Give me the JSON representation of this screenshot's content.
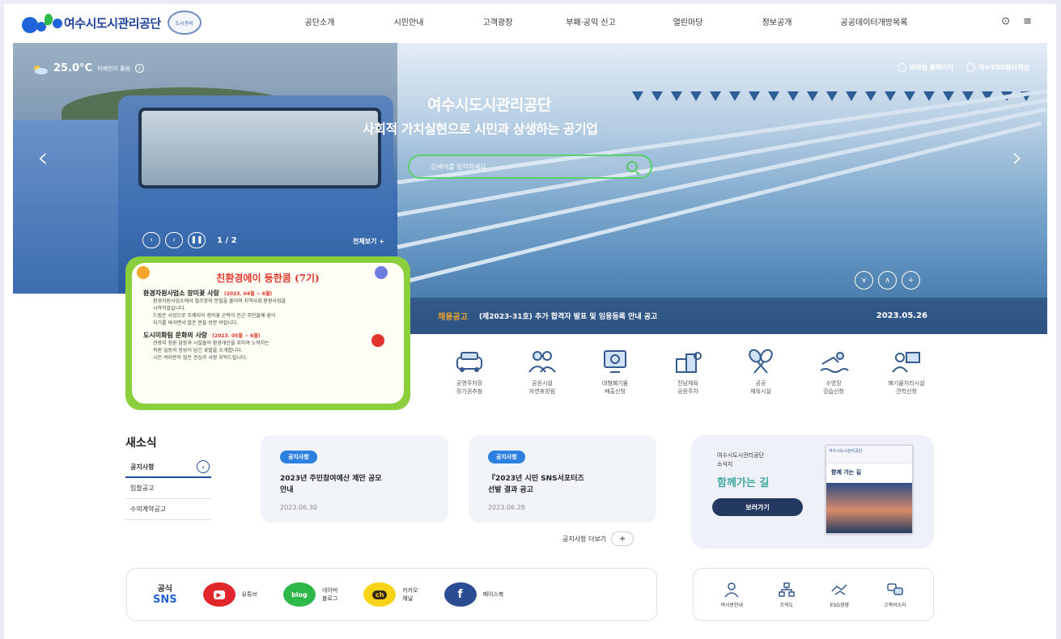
{
  "header": {
    "logo_text": "여수시도시관리공단",
    "emblem_text": "도시관리",
    "nav": [
      "공단소개",
      "시민안내",
      "고객광장",
      "부패·공익 신고",
      "열린마당",
      "정보공개",
      "공공데이터개방목록"
    ]
  },
  "hero": {
    "temperature": "25.0°C",
    "dust_label": "미세먼지 좋음",
    "top_links": [
      "모바일 홈페이지",
      "여수YOU튜브채널"
    ],
    "title": "여수시도시관리공단",
    "subtitle": "사회적 가치실현으로 시민과 상생하는 공기업",
    "search_placeholder": "검색어를 입력하세요",
    "slide_counter": "1 / 2",
    "view_all": "전체보기 +",
    "notice": {
      "category": "채용공고",
      "text": "(제2023-31호) 추가 합격자 발표 및 임용등록 안내 공고",
      "date": "2023.05.26"
    }
  },
  "popup": {
    "title": "친환경에이 등한콤 (7기)",
    "section1": "환경자원사업소 장미꽃 사랑",
    "section1_date": "(2023. 04월 ~ 6월)",
    "lines1": [
      "환경자원사업소에서 철조망의 분필을 줄이며 지역사회 환원사업을",
      "시작하였습니다.",
      "드림은 사업으로 조례되어 장미꽃 군락이 인근 주민들께 쉼이",
      "되기를 바라면서 많은 분들 방문 바랍니다."
    ],
    "section2": "도시미화팀 문화의 사랑",
    "section2_date": "(2023. 05월 ~ 6월)",
    "lines2": [
      "관광지 정원 담장과 시설물의 환경개선을 위하여 노력하는",
      "직원 일동의 정성이 담긴 꽃밭을 소개합니다.",
      "시민 여러분의 많은 관심과 사랑 부탁드립니다."
    ]
  },
  "quick_menu": [
    {
      "label": "공영주차장\n정기권추첨"
    },
    {
      "label": "공원시설\n자연휴양림"
    },
    {
      "label": "대형폐기물\n배출신청"
    },
    {
      "label": "진남체육\n공원주차"
    },
    {
      "label": "공공\n체육시설"
    },
    {
      "label": "수영장\n강습신청"
    },
    {
      "label": "폐기물처리시설\n견학신청"
    }
  ],
  "news": {
    "title": "새소식",
    "tabs": [
      "공지사항",
      "입찰공고",
      "수의계약공고"
    ],
    "cards": [
      {
        "badge": "공지사항",
        "title": "2023년 주민참여예산 제안 공모\n안내",
        "date": "2023.06.30"
      },
      {
        "badge": "공지사항",
        "title": "『2023년 시민 SNS서포터즈\n선발 결과 공고",
        "date": "2023.06.28"
      }
    ],
    "more": "공지사항 더보기"
  },
  "promo": {
    "org": "여수시도시관리공단\n소식지",
    "headline": "함께가는 길",
    "button": "보러가기",
    "book_top": "여수시도시관리공단",
    "book_title": "함께 가는 길"
  },
  "sns": {
    "label_top": "공식",
    "label_bottom": "SNS",
    "items": [
      {
        "icon": "youtube-icon",
        "mark": "▶",
        "name": "유튜브",
        "color": "#e0262a"
      },
      {
        "icon": "blog-icon",
        "mark": "blog",
        "name": "네이버\n블로그",
        "color": "#2fb84a"
      },
      {
        "icon": "kakao-icon",
        "mark": "ch",
        "name": "카카오\n채널",
        "color": "#f7d417"
      },
      {
        "icon": "facebook-icon",
        "mark": "f",
        "name": "페이스북",
        "color": "#2a4c93"
      }
    ]
  },
  "tools": [
    "여사방안내",
    "조직도",
    "ESG경영",
    "고객의소리"
  ],
  "colors": {
    "brand": "#1f64d8",
    "navy": "#23395f",
    "accent_green": "#8ccf3c",
    "notice_orange": "#f4a62a",
    "badge_blue": "#2d7fe0"
  }
}
